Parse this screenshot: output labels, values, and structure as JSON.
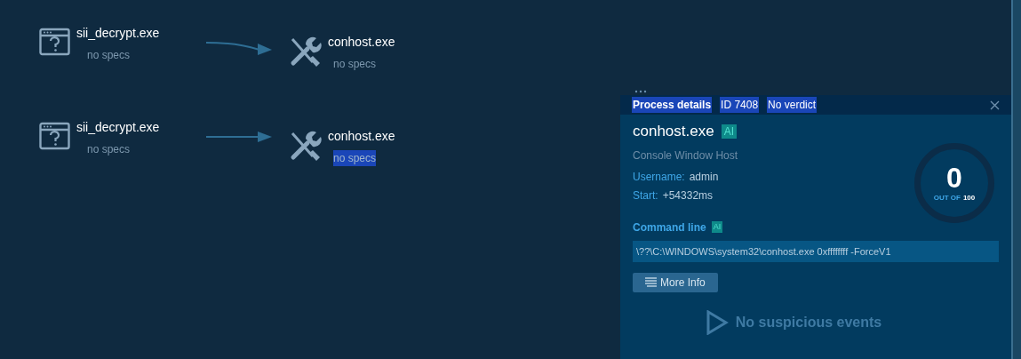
{
  "graph": {
    "rows": [
      {
        "source": {
          "name": "sii_decrypt.exe",
          "specs": "no specs",
          "highlighted": false
        },
        "target": {
          "name": "conhost.exe",
          "specs": "no specs",
          "highlighted": false
        },
        "curved": true
      },
      {
        "source": {
          "name": "sii_decrypt.exe",
          "specs": "no specs",
          "highlighted": false
        },
        "target": {
          "name": "conhost.exe",
          "specs": "no specs",
          "highlighted": true
        },
        "curved": false
      }
    ]
  },
  "panel": {
    "header": [
      {
        "text": "Process details",
        "bold": true,
        "highlighted": true
      },
      {
        "text": "ID 7408",
        "bold": false,
        "highlighted": true
      },
      {
        "text": "No verdict",
        "bold": false,
        "highlighted": true
      }
    ],
    "name": "conhost.exe",
    "name_badge": "AI",
    "description": "Console Window Host",
    "fields": [
      {
        "label": "Username:",
        "value": "admin"
      },
      {
        "label": "Start:",
        "value": "+54332ms"
      }
    ],
    "score": {
      "value": "0",
      "out_of_label": "OUT OF",
      "out_of": "100"
    },
    "command_line": {
      "label": "Command line",
      "badge": "AI",
      "value": "\\??\\C:\\WINDOWS\\system32\\conhost.exe 0xffffffff -ForceV1"
    },
    "more_info_button": "More Info",
    "empty_message": "No suspicious events"
  }
}
